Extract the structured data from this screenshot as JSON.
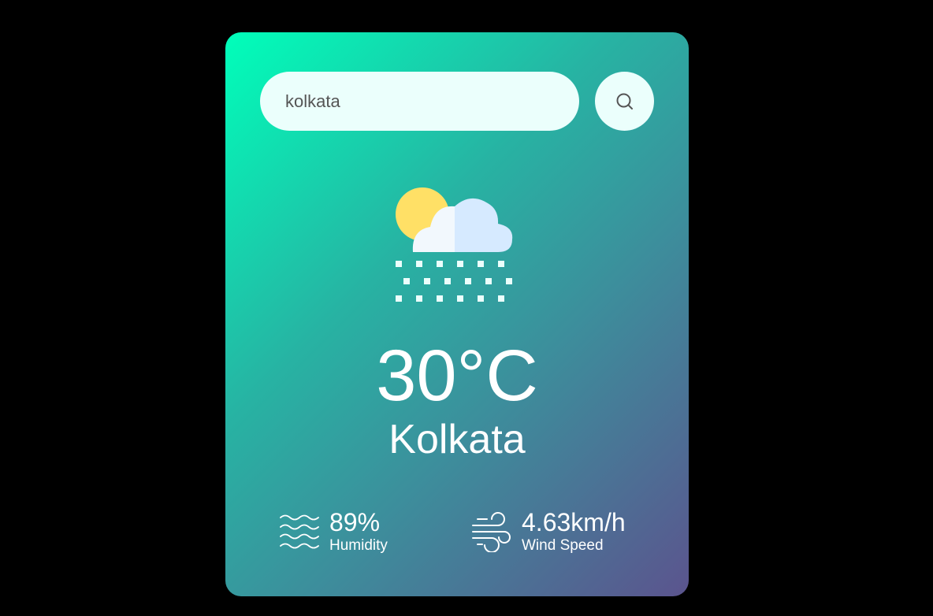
{
  "search": {
    "value": "kolkata",
    "button_icon": "search-icon"
  },
  "weather": {
    "icon": "sun-cloud-snow-icon",
    "temperature": "30°C",
    "city": "Kolkata"
  },
  "details": {
    "humidity": {
      "icon": "humidity-waves-icon",
      "value": "89%",
      "label": "Humidity"
    },
    "wind": {
      "icon": "wind-icon",
      "value": "4.63km/h",
      "label": "Wind Speed"
    }
  },
  "colors": {
    "page_background": "#000000",
    "card_gradient_start": "#00ffba",
    "card_gradient_end": "#5b548e",
    "input_background": "#ebfffc",
    "text": "#ffffff"
  }
}
